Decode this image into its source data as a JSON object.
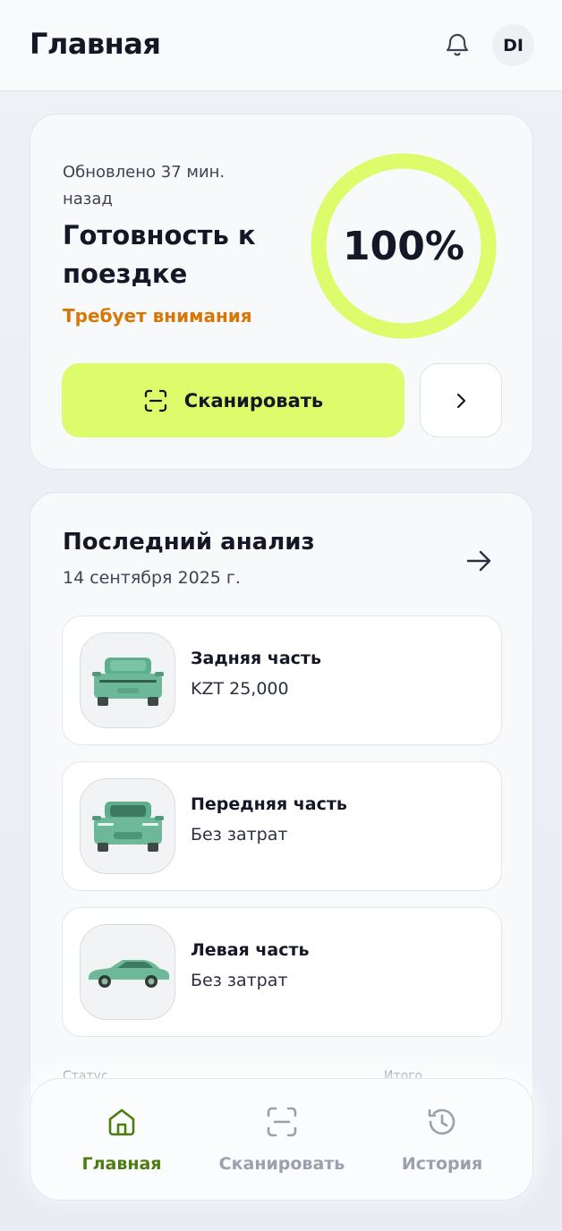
{
  "header": {
    "title": "Главная",
    "avatar_initials": "DI"
  },
  "readiness": {
    "updated": "Обновлено 37 мин. назад",
    "title": "Готовность к поездке",
    "attention": "Требует внимания",
    "percent_label": "100%",
    "percent_value": 1.0,
    "ring_color": "#dcfc6b",
    "scan_button": "Сканировать"
  },
  "analysis": {
    "title": "Последний анализ",
    "date": "14 сентября 2025 г.",
    "items": [
      {
        "title": "Задняя часть",
        "subtitle": "KZT 25,000",
        "icon": "car-rear-icon"
      },
      {
        "title": "Передняя часть",
        "subtitle": "Без затрат",
        "icon": "car-front-icon"
      },
      {
        "title": "Левая часть",
        "subtitle": "Без затрат",
        "icon": "car-side-icon"
      }
    ],
    "footer_left": "Статус",
    "footer_right": "Итого"
  },
  "nav": {
    "home": "Главная",
    "scan": "Сканировать",
    "history": "История",
    "active_color": "#4d7c0f",
    "inactive_color": "#9aa1ad"
  }
}
